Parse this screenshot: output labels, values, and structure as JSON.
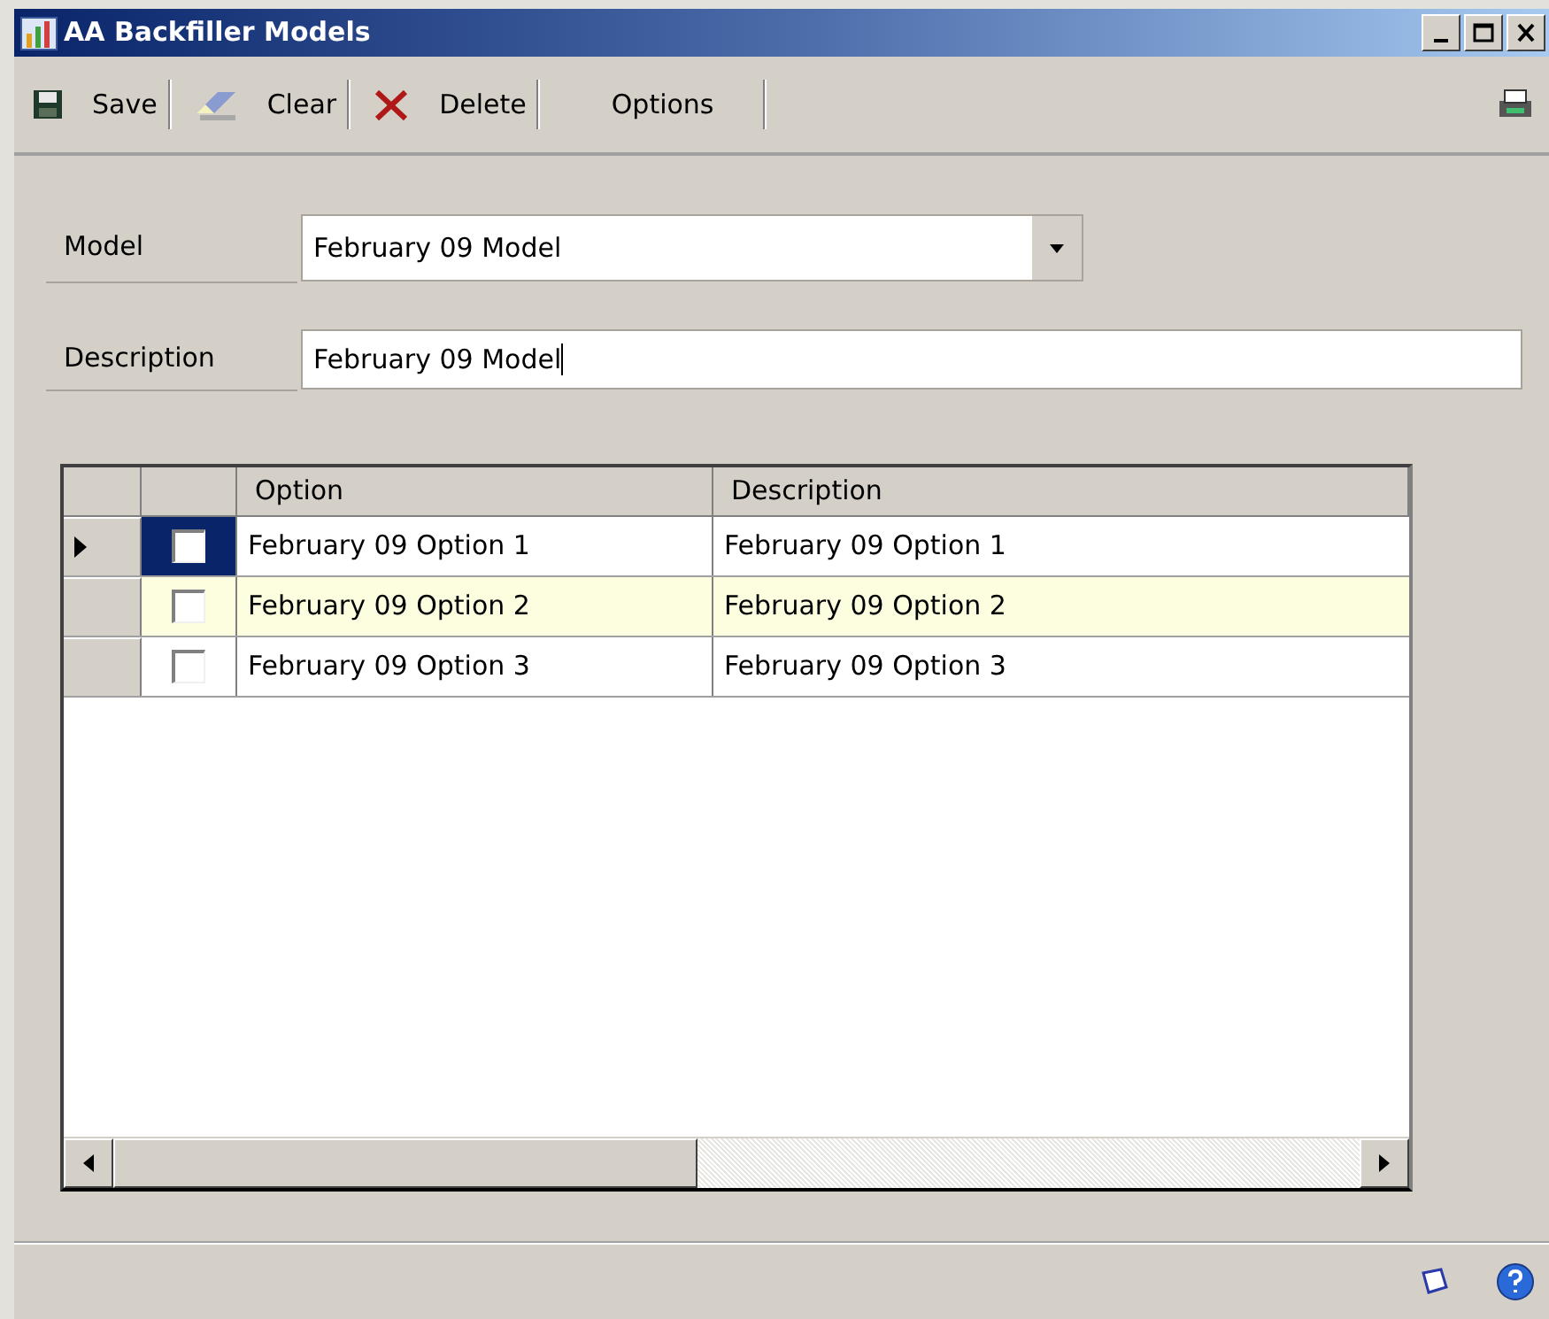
{
  "window": {
    "title": "AA Backfiller Models"
  },
  "toolbar": [
    {
      "kind": "save",
      "label": "Save"
    },
    {
      "kind": "clear",
      "label": "Clear"
    },
    {
      "kind": "delete",
      "label": "Delete"
    },
    {
      "kind": "plain",
      "label": "Options"
    }
  ],
  "form": {
    "model": {
      "label": "Model",
      "value": "February 09 Model"
    },
    "description": {
      "label": "Description",
      "value": "February 09 Model"
    }
  },
  "table": {
    "columns": [
      "Option",
      "Description"
    ],
    "rows": [
      {
        "selected": true,
        "highlighted": false,
        "checked": false,
        "option": "February 09 Option 1",
        "description": "February 09 Option  1"
      },
      {
        "selected": false,
        "highlighted": true,
        "checked": false,
        "option": "February 09 Option 2",
        "description": "February 09 Option 2"
      },
      {
        "selected": false,
        "highlighted": false,
        "checked": false,
        "option": "February 09 Option 3",
        "description": "February 09 Option  3"
      }
    ]
  }
}
